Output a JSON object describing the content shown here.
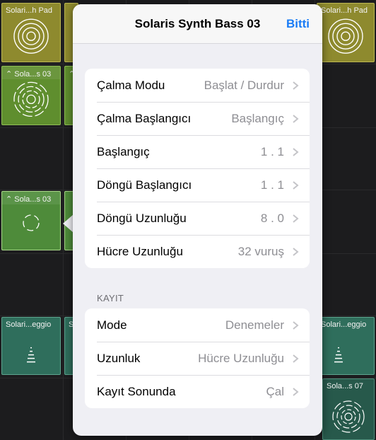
{
  "grid": {
    "cells": [
      {
        "label": "Solari...h Pad",
        "style": "yellow"
      },
      {
        "label": "",
        "style": "yellow"
      },
      {
        "label": "Solari...h Pad",
        "style": "yellow"
      },
      {
        "label": "Sola...s 03",
        "style": "green"
      },
      {
        "label": "",
        "style": "green"
      },
      {
        "label": "Sola...s 03",
        "style": "green-sel"
      },
      {
        "label": "",
        "style": "green"
      },
      {
        "label": "Solari...eggio",
        "style": "teal"
      },
      {
        "label": "S",
        "style": "teal"
      },
      {
        "label": "Solari...eggio",
        "style": "teal"
      },
      {
        "label": "Sola...s 07",
        "style": "teal-dark"
      }
    ]
  },
  "popover": {
    "title": "Solaris Synth Bass 03",
    "done_label": "Bitti",
    "playback_rows": [
      {
        "label": "Çalma Modu",
        "value": "Başlat / Durdur"
      },
      {
        "label": "Çalma Başlangıcı",
        "value": "Başlangıç"
      },
      {
        "label": "Başlangıç",
        "value": "1 . 1"
      },
      {
        "label": "Döngü Başlangıcı",
        "value": "1 . 1"
      },
      {
        "label": "Döngü Uzunluğu",
        "value": "8 . 0"
      },
      {
        "label": "Hücre Uzunluğu",
        "value": "32 vuruş"
      }
    ],
    "record_section_header": "KAYIT",
    "record_rows": [
      {
        "label": "Mode",
        "value": "Denemeler"
      },
      {
        "label": "Uzunluk",
        "value": "Hücre Uzunluğu"
      },
      {
        "label": "Kayıt Sonunda",
        "value": "Çal"
      }
    ]
  },
  "colors": {
    "accent": "#1a7cf5",
    "popover_bg": "#efeff4",
    "app_bg": "#1c1c1e"
  }
}
